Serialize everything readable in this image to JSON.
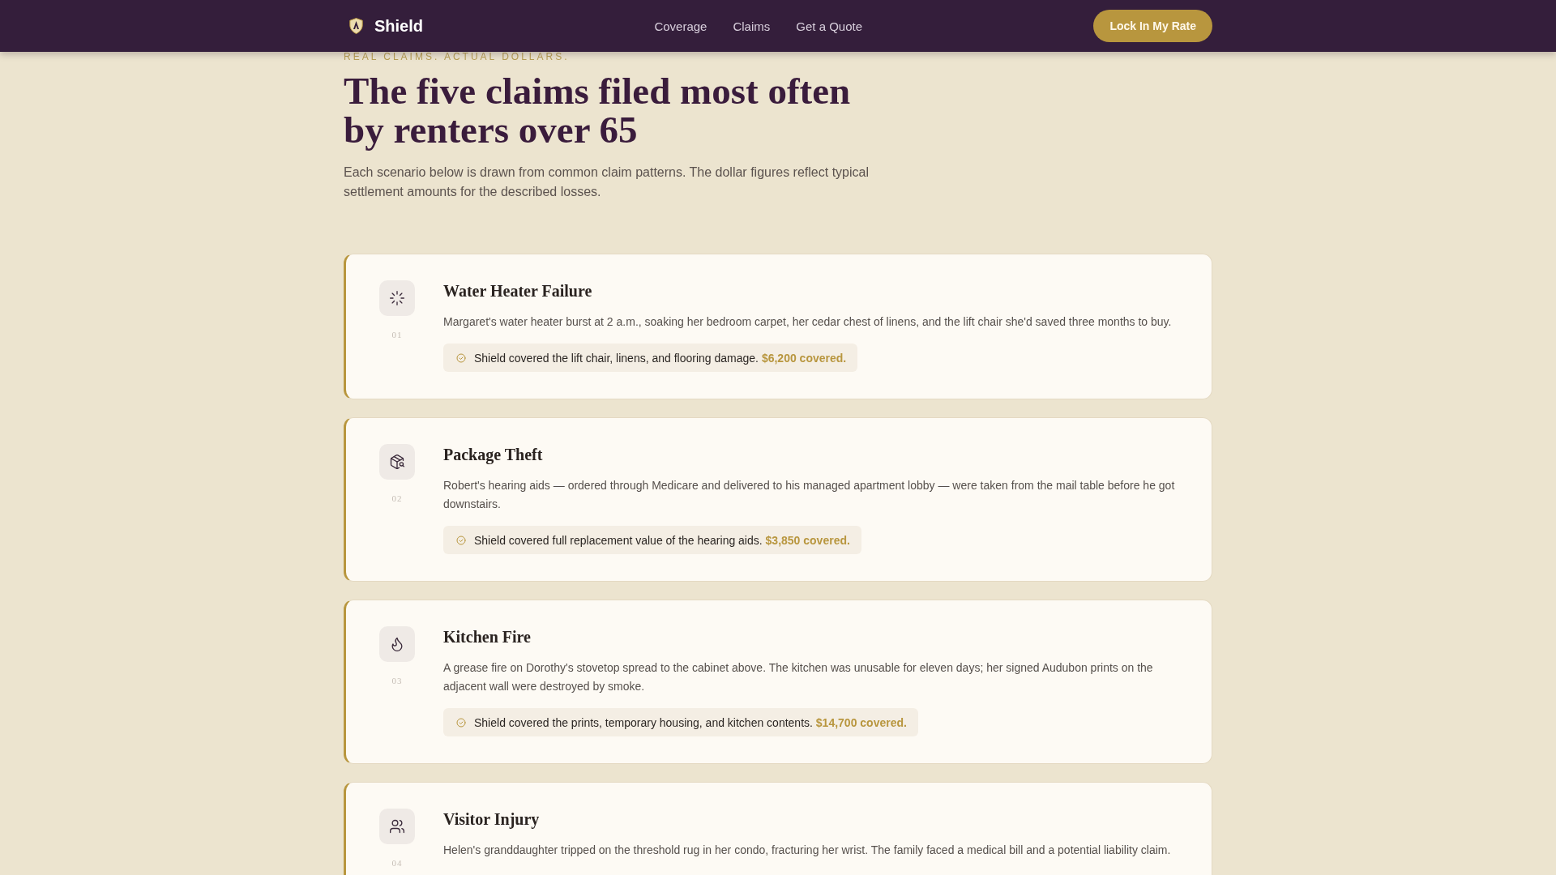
{
  "header": {
    "brand": "Shield",
    "nav": [
      "Coverage",
      "Claims",
      "Get a Quote"
    ],
    "cta": "Lock In My Rate"
  },
  "intro": {
    "eyebrow": "REAL CLAIMS. ACTUAL DOLLARS.",
    "heading": "The five claims filed most often by renters over 65",
    "lead": "Each scenario below is drawn from common claim patterns. The dollar figures reflect typical settlement amounts for the described losses."
  },
  "claims": [
    {
      "number": "01",
      "title": "Water Heater Failure",
      "description": "Margaret's water heater burst at 2 a.m., soaking her bedroom carpet, her cedar chest of linens, and the lift chair she'd saved three months to buy.",
      "coverage": "Shield covered the lift chair, linens, and flooring damage. **$6,200 covered.**"
    },
    {
      "number": "02",
      "title": "Package Theft",
      "description": "Robert's hearing aids — ordered through Medicare and delivered to his managed apartment lobby — were taken from the mail table before he got downstairs.",
      "coverage": "Shield covered full replacement value of the hearing aids. **$3,850 covered.**"
    },
    {
      "number": "03",
      "title": "Kitchen Fire",
      "description": "A grease fire on Dorothy's stovetop spread to the cabinet above. The kitchen was unusable for eleven days; her signed Audubon prints on the adjacent wall were destroyed by smoke.",
      "coverage": "Shield covered the prints, temporary housing, and kitchen contents. **$14,700 covered.**"
    },
    {
      "number": "04",
      "title": "Visitor Injury",
      "description": "Helen's granddaughter tripped on the threshold rug in her condo, fracturing her wrist. The family faced a medical bill and a potential liability claim."
    }
  ]
}
